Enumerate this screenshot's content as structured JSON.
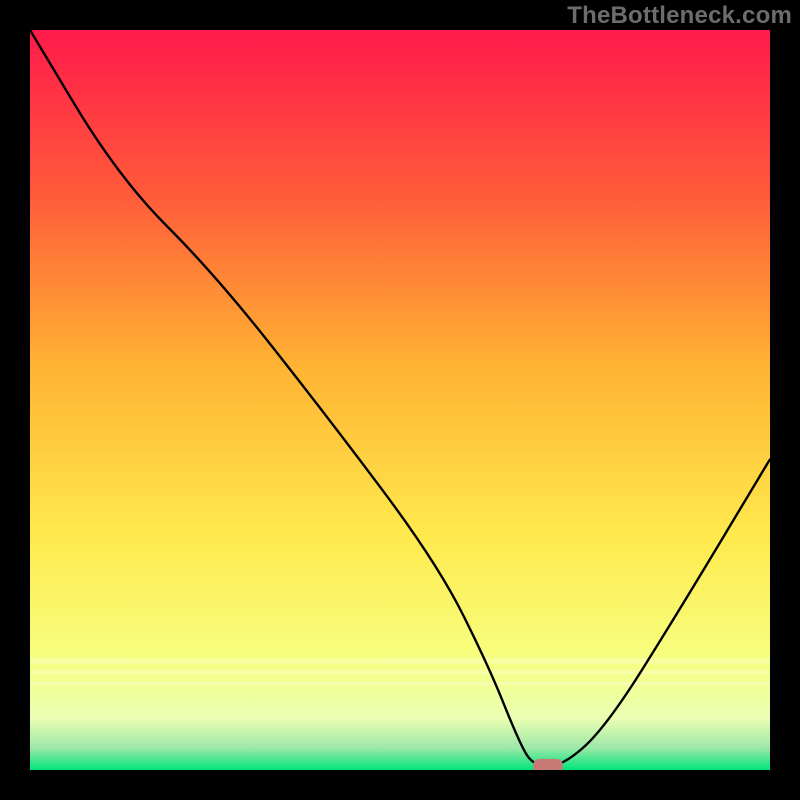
{
  "watermark": "TheBottleneck.com",
  "chart_data": {
    "type": "line",
    "title": "",
    "xlabel": "",
    "ylabel": "",
    "xlim": [
      0,
      100
    ],
    "ylim": [
      0,
      100
    ],
    "grid": false,
    "legend": false,
    "background_gradient": {
      "top": "#ff1a4b",
      "mid1": "#ff7a33",
      "mid2": "#ffd633",
      "mid3": "#f7ff66",
      "bottom_band": "#eaffb3",
      "bottom": "#00e57a"
    },
    "series": [
      {
        "name": "bottleneck-curve",
        "color": "#000000",
        "x": [
          0,
          12,
          25,
          40,
          55,
          62,
          66,
          68,
          72,
          78,
          88,
          100
        ],
        "values": [
          100,
          80,
          67,
          48,
          28,
          14,
          4,
          0.5,
          0.5,
          6,
          22,
          42
        ]
      }
    ],
    "marker": {
      "name": "optimal-marker",
      "x": 70,
      "y": 0.5,
      "width": 4,
      "height": 2,
      "color": "#c77b76"
    }
  }
}
